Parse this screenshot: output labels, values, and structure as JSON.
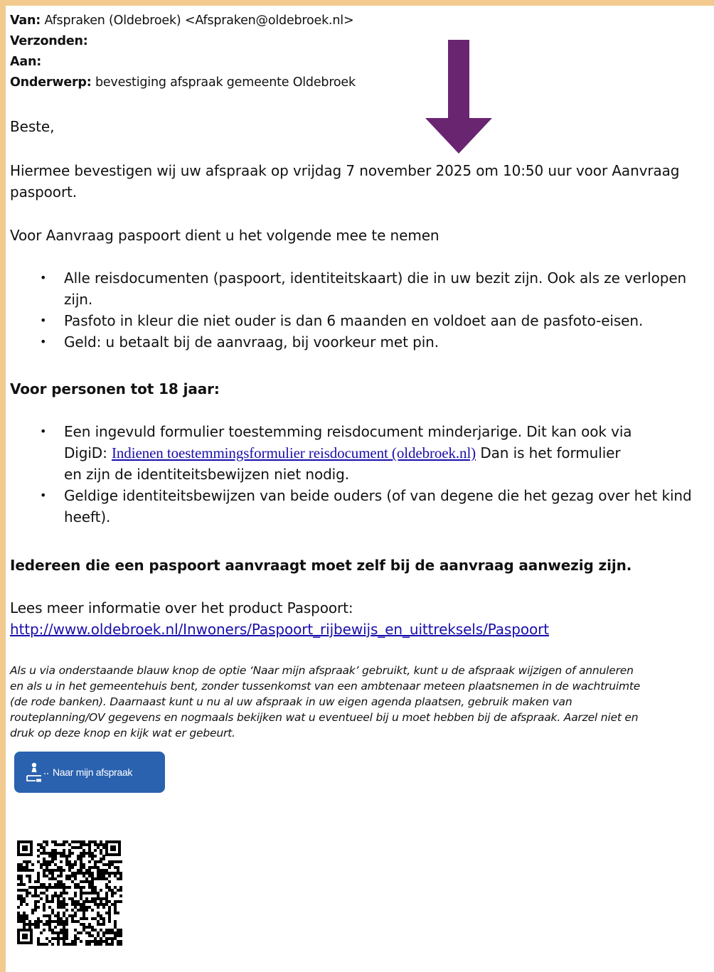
{
  "header": {
    "from_label": "Van:",
    "from_value": "Afspraken (Oldebroek) <Afspraken@oldebroek.nl>",
    "sent_label": "Verzonden:",
    "to_label": "Aan:",
    "subject_label": "Onderwerp:",
    "subject_value": "bevestiging afspraak gemeente Oldebroek"
  },
  "body": {
    "greeting": "Beste,",
    "confirm_line1": "Hiermee bevestigen wij uw afspraak op vrijdag 7 november 2025 om 10:50 uur voor Aanvraag",
    "confirm_line2": "paspoort.",
    "bring_intro": "Voor Aanvraag paspoort dient u het volgende mee te nemen",
    "bring_items": [
      {
        "line1": "Alle reisdocumenten (paspoort, identiteitskaart) die in uw bezit zijn. Ook als ze verlopen",
        "line2": "zijn."
      },
      {
        "line1": "Pasfoto in kleur die niet ouder is dan 6 maanden en voldoet aan de pasfoto-eisen."
      },
      {
        "line1": "Geld: u betaalt bij de aanvraag, bij voorkeur met pin."
      }
    ],
    "minors_heading": "Voor personen tot 18 jaar:",
    "minors_item1_line1": "Een ingevuld formulier toestemming reisdocument minderjarige. Dit kan ook via",
    "minors_item1_prefix": "DigiD: ",
    "minors_item1_link": "Indienen toestemmingsformulier reisdocument (oldebroek.nl)",
    "minors_item1_suffix": " Dan is het formulier",
    "minors_item1_line3": "en zijn de identiteitsbewijzen niet nodig.",
    "minors_item2_line1": "Geldige identiteitsbewijzen van beide ouders (of van degene die het gezag over het kind",
    "minors_item2_line2": "heeft).",
    "everyone": "Iedereen die een paspoort aanvraagt moet zelf bij de aanvraag aanwezig zijn.",
    "more_info": "Lees meer informatie over het product Paspoort:",
    "more_info_url": "http://www.oldebroek.nl/Inwoners/Paspoort_rijbewijs_en_uittreksels/Paspoort",
    "italic_lines": [
      "Als u via onderstaande blauw knop de optie ‘Naar mijn afspraak’ gebruikt, kunt u de afspraak wijzigen of annuleren",
      "en als u in het gemeentehuis bent, zonder tussenkomst van een ambtenaar meteen plaatsnemen in de wachtruimte",
      "(de rode banken). Daarnaast kunt u nu al uw afspraak in uw eigen agenda plaatsen, gebruik maken van",
      "routeplanning/OV gegevens en nogmaals bekijken wat u eventueel bij u moet hebben bij de afspraak. Aarzel niet en",
      "druk op deze knop en kijk wat er gebeurt."
    ],
    "button_label": "Naar mijn afspraak"
  },
  "colors": {
    "frame": "#f2c98f",
    "arrow": "#6a2570",
    "button": "#2b62b0",
    "link": "#1a0dab"
  },
  "icons": [
    "down-arrow-icon",
    "location-person-icon",
    "qr-code"
  ]
}
